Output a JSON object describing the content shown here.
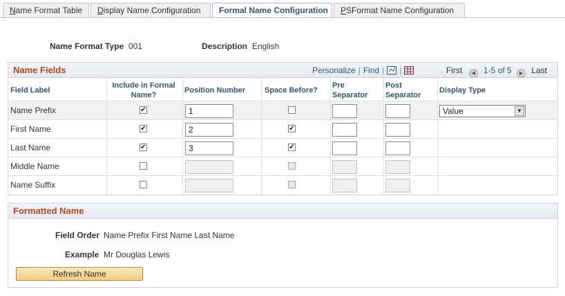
{
  "tabs": [
    {
      "label": "Name Format Table",
      "underline": "N",
      "rest": "ame Format Table"
    },
    {
      "label": "Display Name Configuration",
      "underline": "D",
      "rest": "isplay Name Configuration"
    },
    {
      "label": "Formal Name Configuration",
      "underline": "",
      "rest": "Formal Name Configuration"
    },
    {
      "label": "PSFormat Name Configuration",
      "underline": "P",
      "rest": "SFormat Name Configuration"
    }
  ],
  "header": {
    "name_format_type_label": "Name Format Type",
    "name_format_type_value": "001",
    "description_label": "Description",
    "description_value": "English"
  },
  "name_fields": {
    "title": "Name Fields",
    "personalize": "Personalize",
    "find": "Find",
    "sep": "|",
    "first": "First",
    "range": "1-5 of 5",
    "last": "Last",
    "columns": {
      "field_label": "Field Label",
      "include_1": "Include in Formal",
      "include_2": "Name?",
      "position": "Position Number",
      "space_before": "Space Before?",
      "pre_1": "Pre",
      "pre_2": "Separator",
      "post_1": "Post",
      "post_2": "Separator",
      "display_type": "Display Type"
    },
    "rows": [
      {
        "label": "Name Prefix",
        "include": true,
        "position": "1",
        "space_before": false,
        "pre": "",
        "post": "",
        "display_type": "Value",
        "enabled": true
      },
      {
        "label": "First Name",
        "include": true,
        "position": "2",
        "space_before": true,
        "pre": "",
        "post": "",
        "display_type": "",
        "enabled": true
      },
      {
        "label": "Last Name",
        "include": true,
        "position": "3",
        "space_before": true,
        "pre": "",
        "post": "",
        "display_type": "",
        "enabled": true
      },
      {
        "label": "Middle Name",
        "include": false,
        "position": "",
        "space_before": false,
        "pre": "",
        "post": "",
        "display_type": "",
        "enabled": false
      },
      {
        "label": "Name Suffix",
        "include": false,
        "position": "",
        "space_before": false,
        "pre": "",
        "post": "",
        "display_type": "",
        "enabled": false
      }
    ]
  },
  "formatted_name": {
    "title": "Formatted Name",
    "field_order_label": "Field Order",
    "field_order_value": "Name Prefix First Name Last Name",
    "example_label": "Example",
    "example_value": "Mr Douglas Lewis",
    "refresh_button": "Refresh Name"
  },
  "colors": {
    "section_title": "#b5481e",
    "link": "#31556f",
    "button": "#f2cc80"
  }
}
